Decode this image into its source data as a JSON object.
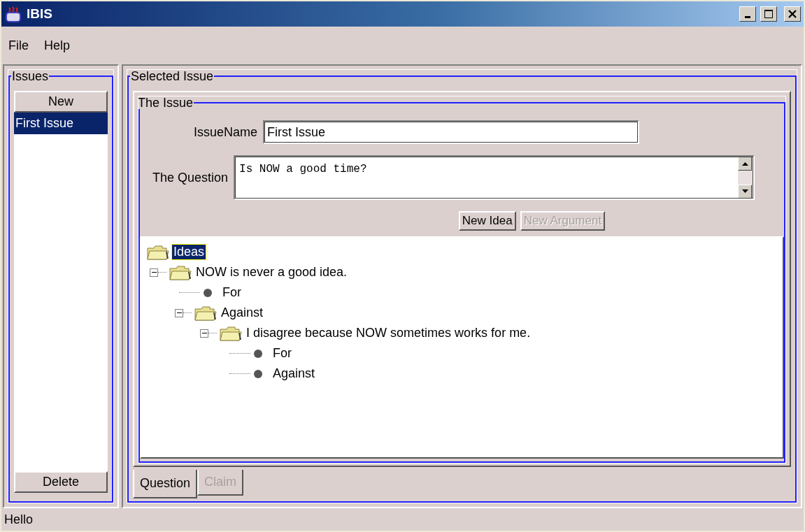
{
  "window": {
    "title": "IBIS"
  },
  "menu": [
    "File",
    "Help"
  ],
  "issues_panel": {
    "title": "Issues",
    "new_button": "New",
    "items": [
      {
        "label": "First Issue",
        "selected": true
      }
    ],
    "delete_button": "Delete"
  },
  "selected_issue": {
    "title": "Selected Issue",
    "issue_group": {
      "title": "The Issue",
      "issue_name_label": "IssueName",
      "issue_name": "First Issue",
      "question_label": "The Question",
      "question": "Is NOW a good time?",
      "buttons": [
        {
          "label": "New Idea",
          "disabled": false
        },
        {
          "label": "New Argument",
          "disabled": true
        }
      ]
    },
    "tree": [
      {
        "label": "Ideas",
        "kind": "folder",
        "selected": true,
        "children": [
          {
            "label": "NOW is never a good idea.",
            "kind": "folder",
            "selected": false,
            "expanded": true,
            "children": [
              {
                "label": "For",
                "kind": "leaf",
                "selected": false
              },
              {
                "label": "Against",
                "kind": "folder",
                "selected": false,
                "expanded": true,
                "children": [
                  {
                    "label": "I disagree because NOW sometimes works for me.",
                    "kind": "folder",
                    "selected": false,
                    "expanded": true,
                    "children": [
                      {
                        "label": "For",
                        "kind": "leaf",
                        "selected": false
                      },
                      {
                        "label": "Against",
                        "kind": "leaf",
                        "selected": false
                      }
                    ]
                  }
                ]
              }
            ]
          }
        ]
      }
    ],
    "tabs": [
      {
        "label": "Question",
        "selected": true,
        "disabled": false
      },
      {
        "label": "Claim",
        "selected": false,
        "disabled": true
      }
    ]
  },
  "status_bar": "Hello"
}
